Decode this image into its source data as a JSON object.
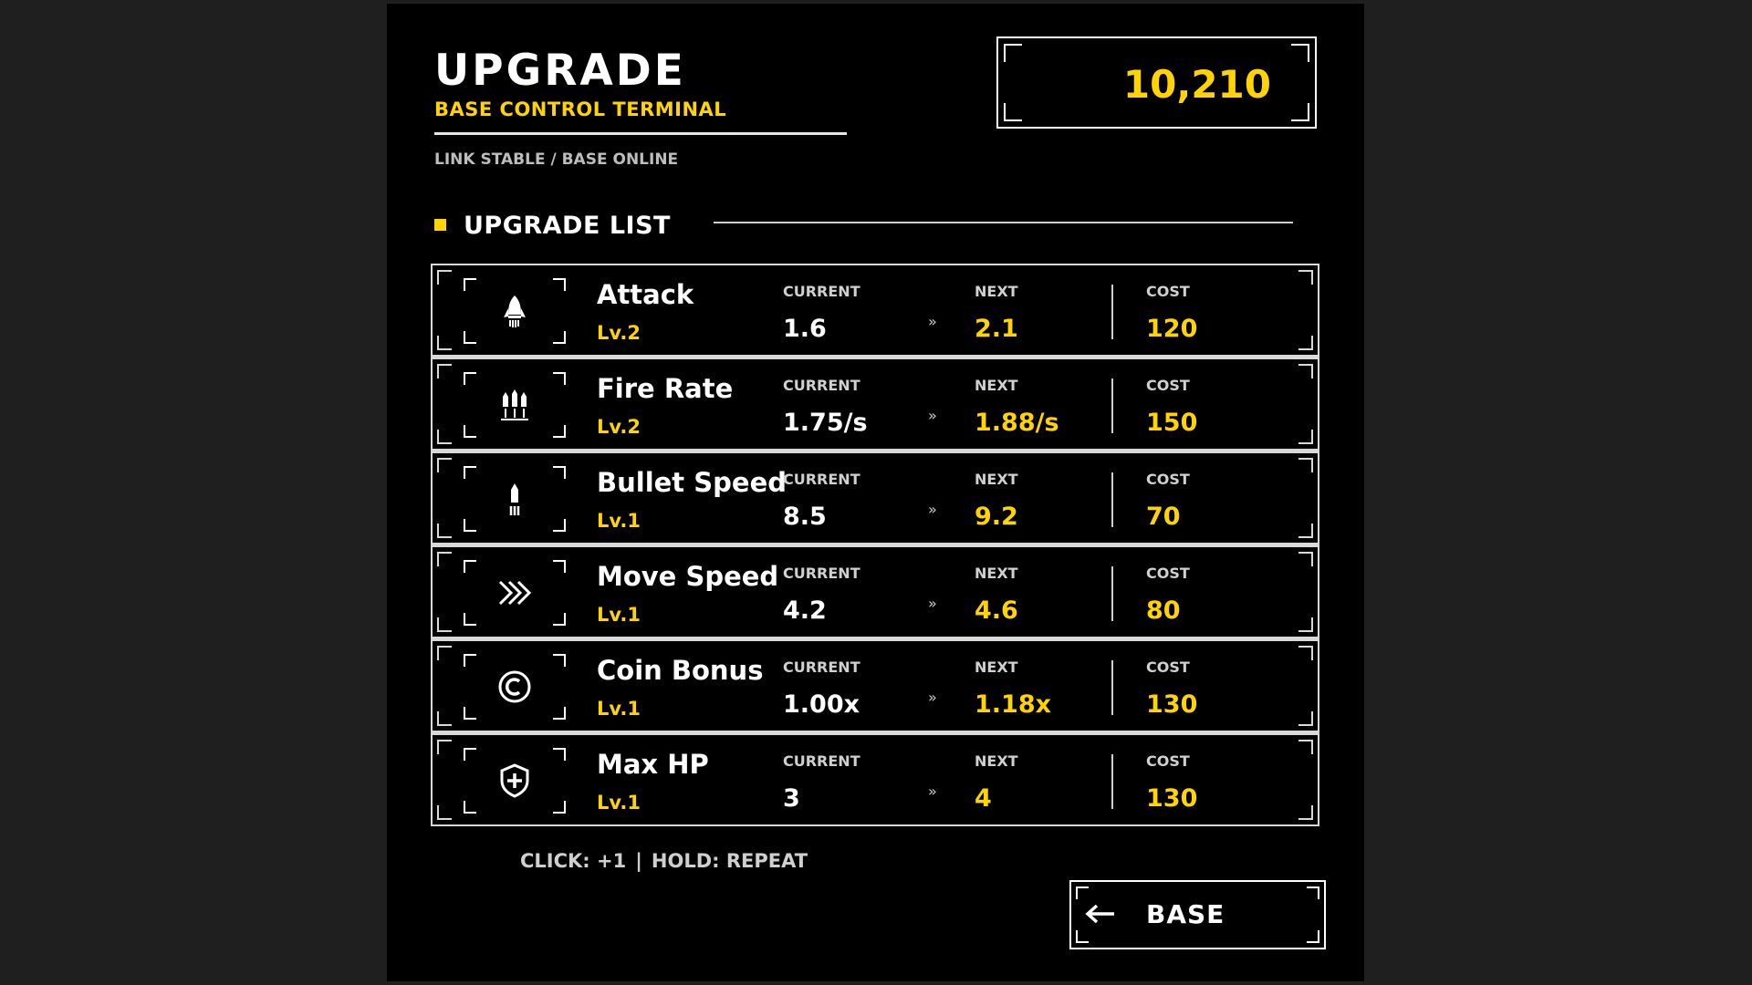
{
  "header": {
    "title": "UPGRADE",
    "subtitle": "BASE CONTROL TERMINAL",
    "status": "LINK STABLE / BASE ONLINE"
  },
  "coins": {
    "value": "10,210"
  },
  "list": {
    "title": "UPGRADE LIST",
    "col_current": "CURRENT",
    "col_next": "NEXT",
    "col_cost": "COST",
    "arrow": "»"
  },
  "upgrades": [
    {
      "name": "Attack",
      "level": "Lv.2",
      "current": "1.6",
      "next": "2.1",
      "cost": "120",
      "icon": "rocket-icon"
    },
    {
      "name": "Fire Rate",
      "level": "Lv.2",
      "current": "1.75/s",
      "next": "1.88/s",
      "cost": "150",
      "icon": "bullets-icon"
    },
    {
      "name": "Bullet Speed",
      "level": "Lv.1",
      "current": "8.5",
      "next": "9.2",
      "cost": "70",
      "icon": "bullet-speed-icon"
    },
    {
      "name": "Move Speed",
      "level": "Lv.1",
      "current": "4.2",
      "next": "4.6",
      "cost": "80",
      "icon": "triple-chevron-icon"
    },
    {
      "name": "Coin Bonus",
      "level": "Lv.1",
      "current": "1.00x",
      "next": "1.18x",
      "cost": "130",
      "icon": "coin-icon"
    },
    {
      "name": "Max HP",
      "level": "Lv.1",
      "current": "3",
      "next": "4",
      "cost": "130",
      "icon": "shield-plus-icon"
    }
  ],
  "hint": {
    "click": "CLICK: +1",
    "separator": "|",
    "hold": "HOLD: REPEAT"
  },
  "base_button": {
    "label": "BASE"
  },
  "colors": {
    "accent": "#ffd400",
    "background": "#000000",
    "outer_background": "#1f1f1f",
    "text": "#ffffff"
  }
}
